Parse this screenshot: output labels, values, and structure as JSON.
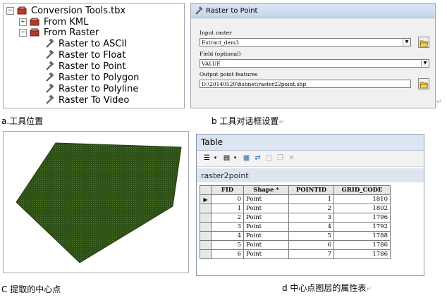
{
  "panel_a": {
    "toolbox_label": "Conversion Tools.tbx",
    "toolsets": [
      {
        "label": "From KML",
        "expander": "+"
      },
      {
        "label": "From Raster",
        "expander": "−"
      }
    ],
    "tools": [
      "Raster to ASCII",
      "Raster to Float",
      "Raster to Point",
      "Raster to Polygon",
      "Raster to Polyline",
      "Raster To Video"
    ],
    "caption": "a.工具位置"
  },
  "panel_b": {
    "title": "Raster to Point",
    "input_raster_label": "Input raster",
    "input_raster_value": "Extract_dem3",
    "field_label": "Field (optional)",
    "field_value": "VALUE",
    "output_label": "Output point features",
    "output_value": "D:\\20140520\\fishnet\\raster22point.shp",
    "caption": "b  工具对话框设置"
  },
  "panel_c": {
    "caption": "C 提取的中心点",
    "fill_color": "#2d5016"
  },
  "panel_d": {
    "title": "Table",
    "table_name": "raster2point",
    "columns": [
      "FID",
      "Shape *",
      "POINTID",
      "GRID_CODE"
    ],
    "rows": [
      {
        "fid": "0",
        "shape": "Point",
        "pointid": "1",
        "grid_code": "1810"
      },
      {
        "fid": "1",
        "shape": "Point",
        "pointid": "2",
        "grid_code": "1802"
      },
      {
        "fid": "2",
        "shape": "Point",
        "pointid": "3",
        "grid_code": "1796"
      },
      {
        "fid": "3",
        "shape": "Point",
        "pointid": "4",
        "grid_code": "1792"
      },
      {
        "fid": "4",
        "shape": "Point",
        "pointid": "5",
        "grid_code": "1788"
      },
      {
        "fid": "5",
        "shape": "Point",
        "pointid": "6",
        "grid_code": "1786"
      },
      {
        "fid": "6",
        "shape": "Point",
        "pointid": "7",
        "grid_code": "1786"
      }
    ],
    "caption": "d 中心点图层的属性表"
  },
  "return_mark": "↵"
}
